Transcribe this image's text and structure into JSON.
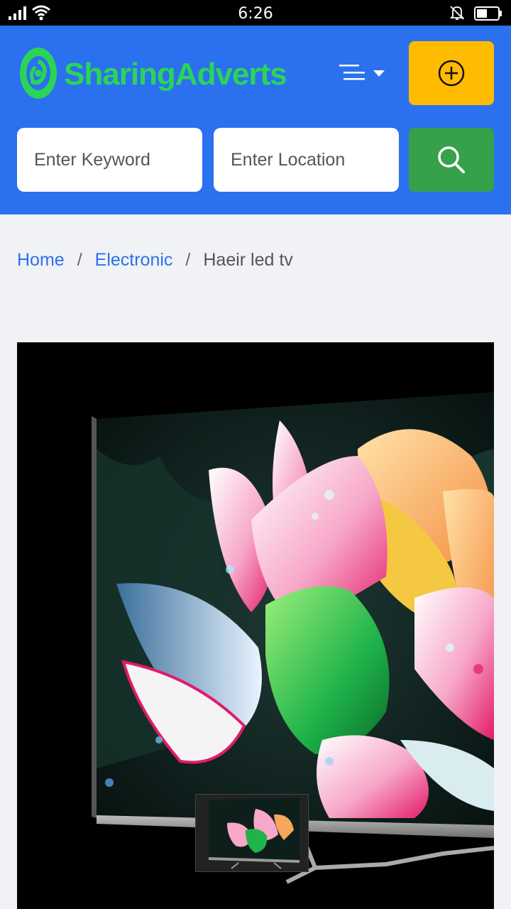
{
  "status_bar": {
    "time": "6:26"
  },
  "header": {
    "brand": "SharingAdverts",
    "brand_color": "#2ad556",
    "background_color": "#2b70ee",
    "menu_icon": "hamburger-menu-icon",
    "post_icon": "plus-circle-icon",
    "post_color": "#ffbb00"
  },
  "search": {
    "keyword_placeholder": "Enter Keyword",
    "location_placeholder": "Enter Location",
    "button_icon": "search-icon",
    "button_color": "#36a04a"
  },
  "breadcrumb": {
    "items": [
      "Home",
      "Electronic"
    ],
    "separator": "/",
    "current": "Haeir led tv"
  },
  "product": {
    "image_subject": "led-tv-lotus-flower-image"
  }
}
